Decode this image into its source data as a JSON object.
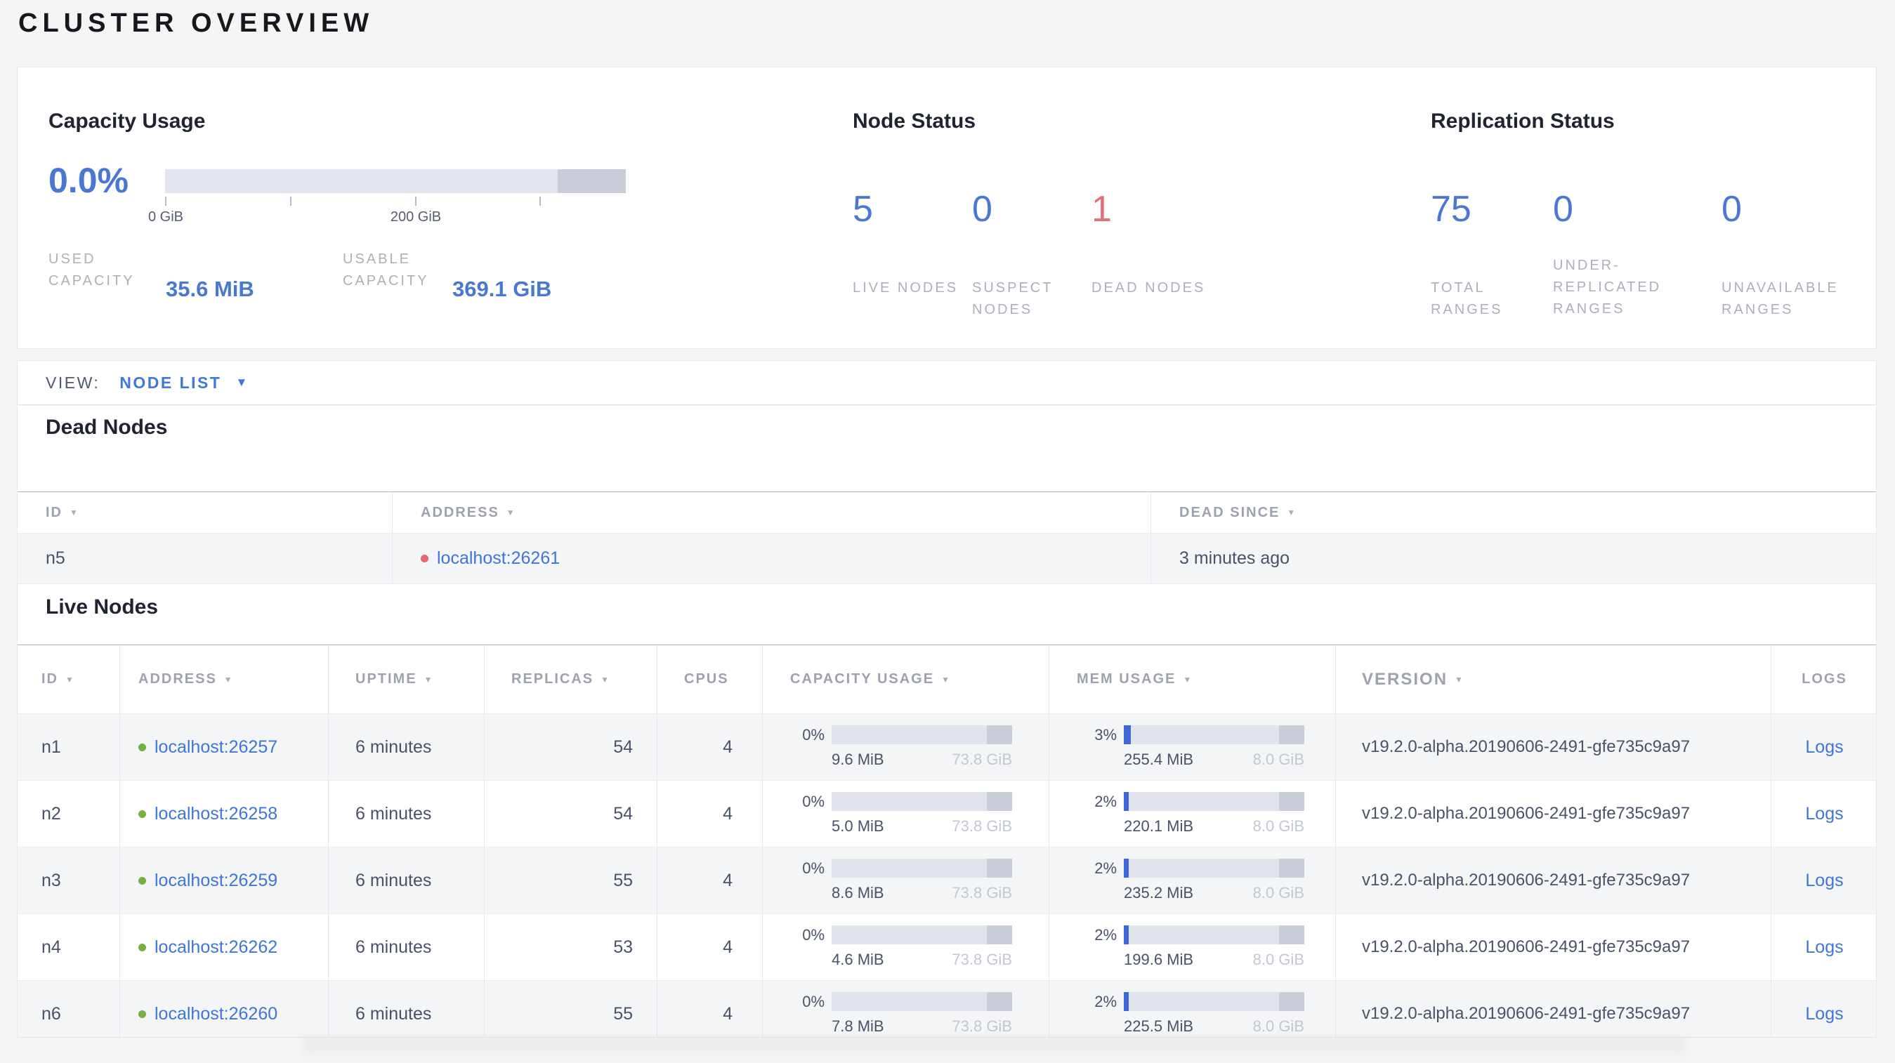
{
  "page": {
    "title": "CLUSTER OVERVIEW"
  },
  "colors": {
    "accent_blue": "#4878D2",
    "link_blue": "#3D76DB",
    "alert_red": "#E0707E",
    "live_green": "#75B041",
    "dead_red": "#E16A70"
  },
  "overview": {
    "capacity": {
      "title": "Capacity Usage",
      "percent": "0.0%",
      "bar": {
        "dark_segment_width": "14.8%"
      },
      "axis": {
        "tick0": "0 GiB",
        "tick2": "200 GiB"
      },
      "used": {
        "label": "USED CAPACITY",
        "value": "35.6 MiB"
      },
      "usable": {
        "label": "USABLE CAPACITY",
        "value": "369.1 GiB"
      }
    },
    "node_status": {
      "title": "Node Status",
      "live": {
        "value": "5",
        "label": "LIVE NODES"
      },
      "suspect": {
        "value": "0",
        "label": "SUSPECT NODES"
      },
      "dead": {
        "value": "1",
        "label": "DEAD NODES"
      }
    },
    "replication": {
      "title": "Replication Status",
      "total": {
        "value": "75",
        "label": "TOTAL RANGES"
      },
      "under_replicated": {
        "value": "0",
        "label": "UNDER-REPLICATED RANGES"
      },
      "unavailable": {
        "value": "0",
        "label": "UNAVAILABLE RANGES"
      }
    }
  },
  "view_bar": {
    "label": "VIEW:",
    "selected": "NODE LIST"
  },
  "dead_nodes": {
    "title": "Dead Nodes",
    "headers": {
      "id": "ID",
      "address": "ADDRESS",
      "dead_since": "DEAD SINCE"
    },
    "rows": [
      {
        "id": "n5",
        "address": "localhost:26261",
        "dead_since": "3 minutes ago"
      }
    ]
  },
  "live_nodes": {
    "title": "Live Nodes",
    "headers": {
      "id": "ID",
      "address": "ADDRESS",
      "uptime": "UPTIME",
      "replicas": "REPLICAS",
      "cpus": "CPUS",
      "capacity": "CAPACITY USAGE",
      "mem": "MEM USAGE",
      "version": "VERSION",
      "logs": "LOGS"
    },
    "logs_label": "Logs",
    "rows": [
      {
        "id": "n1",
        "address": "localhost:26257",
        "uptime": "6 minutes",
        "replicas": "54",
        "cpus": "4",
        "capacity": {
          "pct": "0%",
          "used": "9.6 MiB",
          "total": "73.8 GiB"
        },
        "mem": {
          "pct": "3%",
          "used": "255.4 MiB",
          "total": "8.0 GiB",
          "fill_px": "10px"
        },
        "version": "v19.2.0-alpha.20190606-2491-gfe735c9a97"
      },
      {
        "id": "n2",
        "address": "localhost:26258",
        "uptime": "6 minutes",
        "replicas": "54",
        "cpus": "4",
        "capacity": {
          "pct": "0%",
          "used": "5.0 MiB",
          "total": "73.8 GiB"
        },
        "mem": {
          "pct": "2%",
          "used": "220.1 MiB",
          "total": "8.0 GiB",
          "fill_px": "7px"
        },
        "version": "v19.2.0-alpha.20190606-2491-gfe735c9a97"
      },
      {
        "id": "n3",
        "address": "localhost:26259",
        "uptime": "6 minutes",
        "replicas": "55",
        "cpus": "4",
        "capacity": {
          "pct": "0%",
          "used": "8.6 MiB",
          "total": "73.8 GiB"
        },
        "mem": {
          "pct": "2%",
          "used": "235.2 MiB",
          "total": "8.0 GiB",
          "fill_px": "7px"
        },
        "version": "v19.2.0-alpha.20190606-2491-gfe735c9a97"
      },
      {
        "id": "n4",
        "address": "localhost:26262",
        "uptime": "6 minutes",
        "replicas": "53",
        "cpus": "4",
        "capacity": {
          "pct": "0%",
          "used": "4.6 MiB",
          "total": "73.8 GiB"
        },
        "mem": {
          "pct": "2%",
          "used": "199.6 MiB",
          "total": "8.0 GiB",
          "fill_px": "7px"
        },
        "version": "v19.2.0-alpha.20190606-2491-gfe735c9a97"
      },
      {
        "id": "n6",
        "address": "localhost:26260",
        "uptime": "6 minutes",
        "replicas": "55",
        "cpus": "4",
        "capacity": {
          "pct": "0%",
          "used": "7.8 MiB",
          "total": "73.8 GiB"
        },
        "mem": {
          "pct": "2%",
          "used": "225.5 MiB",
          "total": "8.0 GiB",
          "fill_px": "7px"
        },
        "version": "v19.2.0-alpha.20190606-2491-gfe735c9a97"
      }
    ]
  }
}
